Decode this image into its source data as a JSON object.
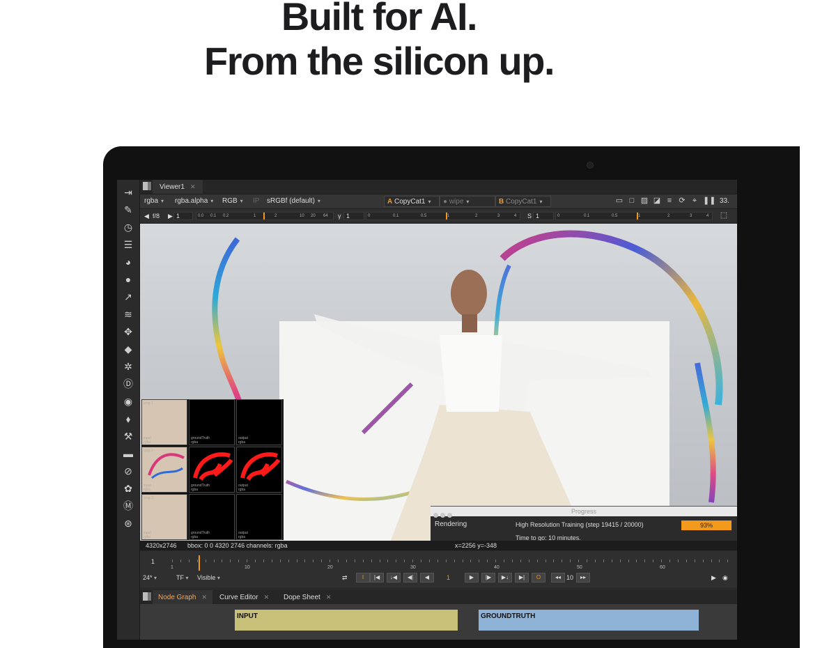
{
  "headline": {
    "line1": "Built for AI.",
    "line2": "From the silicon up."
  },
  "viewer_tab": {
    "label": "Viewer1"
  },
  "toolbar": {
    "channels": "rgba",
    "layer": "rgba.alpha",
    "display": "RGB",
    "ip_label": "IP",
    "colorspace": "sRGBf (default)",
    "a_label": "A",
    "a_input": "CopyCat1",
    "wipe": "wipe",
    "b_label": "B",
    "b_input": "CopyCat1",
    "zoom": "33."
  },
  "toolbar2": {
    "fstop": "f/8",
    "frame": "1",
    "gain_ticks": [
      "0.0",
      "0.1",
      "0.2",
      "1",
      "2",
      "10",
      "20",
      "64"
    ],
    "gamma_label": "γ",
    "gamma_value": "1",
    "gamma_ticks": [
      "0",
      "0.1",
      "0.5",
      "1",
      "2",
      "3",
      "4"
    ],
    "s_label": "S",
    "s_value": "1",
    "s_ticks": [
      "0",
      "0.1",
      "0.5",
      "1",
      "2",
      "3",
      "4"
    ]
  },
  "grid": {
    "rows": [
      {
        "label": "crop 1",
        "cells": [
          [
            "input",
            "rgba"
          ],
          [
            "groundTruth",
            "rgba"
          ],
          [
            "output",
            "rgba"
          ]
        ]
      },
      {
        "label": "crop 2",
        "cells": [
          [
            "input",
            "rgba"
          ],
          [
            "groundTruth",
            "rgba"
          ],
          [
            "output",
            "rgba"
          ]
        ]
      },
      {
        "label": "crop 3",
        "cells": [
          [
            "input",
            "rgba"
          ],
          [
            "groundTruth",
            "rgba"
          ],
          [
            "output",
            "rgba"
          ]
        ]
      }
    ]
  },
  "progress": {
    "title": "Progress",
    "status": "Rendering",
    "task": "High Resolution Training (step 19415 / 20000)",
    "eta": "Time to go: 10 minutes.",
    "percent_label": "93%",
    "percent": 93
  },
  "infobar": {
    "resolution": "4320x2746",
    "bbox": "bbox: 0 0 4320 2746 channels: rgba",
    "coords": "x=2256 y=-348"
  },
  "timeline": {
    "frame": "1",
    "ticks": [
      "1",
      "10",
      "20",
      "30",
      "40",
      "50",
      "60"
    ],
    "fps": "24*",
    "tf": "TF",
    "visible": "Visible",
    "in_label": "I",
    "out_label": "O",
    "current_frame": "1",
    "step": "10"
  },
  "node_graph": {
    "tabs": [
      "Node Graph",
      "Curve Editor",
      "Dope Sheet"
    ],
    "nodes": [
      "INPUT",
      "GROUNDTRUTH"
    ]
  },
  "colors": {
    "accent": "#f39a1c",
    "input_node": "#c8bf78",
    "groundtruth_node": "#8fb3d6"
  }
}
